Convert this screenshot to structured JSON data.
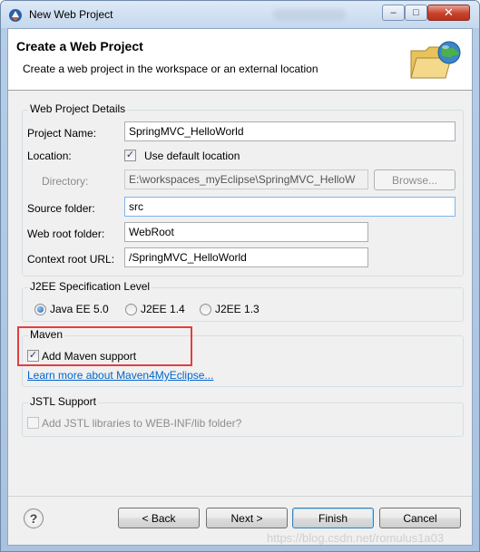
{
  "window": {
    "title": "New Web Project",
    "controls": {
      "minimize": "–",
      "maximize": "□",
      "close": "✕"
    }
  },
  "banner": {
    "title": "Create a Web Project",
    "description": "Create a web project in the workspace or an external location",
    "icon": "folder-globe-icon"
  },
  "details": {
    "group_label": "Web Project Details",
    "project_name_label": "Project Name:",
    "project_name_value": "SpringMVC_HelloWorld",
    "location_label": "Location:",
    "use_default_label": "Use default location",
    "use_default_checked": true,
    "directory_label": "Directory:",
    "directory_value": "E:\\workspaces_myEclipse\\SpringMVC_HelloW",
    "browse_label": "Browse...",
    "source_folder_label": "Source folder:",
    "source_folder_value": "src",
    "web_root_label": "Web root folder:",
    "web_root_value": "WebRoot",
    "context_root_label": "Context root URL:",
    "context_root_value": "/SpringMVC_HelloWorld"
  },
  "j2ee": {
    "group_label": "J2EE Specification Level",
    "options": [
      "Java EE 5.0",
      "J2EE 1.4",
      "J2EE 1.3"
    ],
    "selected": "Java EE 5.0"
  },
  "maven": {
    "group_label": "Maven",
    "add_support_label": "Add Maven support",
    "add_support_checked": true,
    "learn_more_link": "Learn more about Maven4MyEclipse..."
  },
  "jstl": {
    "group_label": "JSTL Support",
    "add_jstl_label": "Add JSTL libraries to WEB-INF/lib folder?",
    "add_jstl_checked": false
  },
  "footer": {
    "back_label": "< Back",
    "next_label": "Next >",
    "finish_label": "Finish",
    "cancel_label": "Cancel",
    "watermark": "https://blog.csdn.net/romulus1a03"
  },
  "colors": {
    "highlight_border": "#e33e3e",
    "link": "#0066cc",
    "title_bar": "#c5d8ee"
  }
}
